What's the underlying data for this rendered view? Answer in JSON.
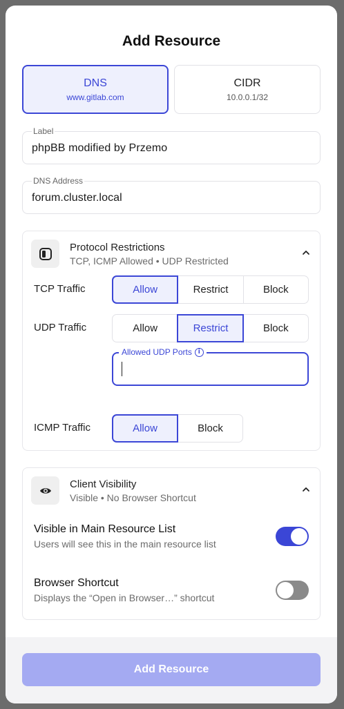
{
  "modal": {
    "title": "Add Resource"
  },
  "resource_type": {
    "options": [
      {
        "label": "DNS",
        "example": "www.gitlab.com",
        "selected": true
      },
      {
        "label": "CIDR",
        "example": "10.0.0.1/32",
        "selected": false
      }
    ]
  },
  "fields": {
    "label": {
      "label": "Label",
      "value": "phpBB modified by Przemo"
    },
    "dns_address": {
      "label": "DNS Address",
      "value": "forum.cluster.local"
    }
  },
  "protocol": {
    "title": "Protocol Restrictions",
    "summary": "TCP, ICMP Allowed • UDP Restricted",
    "rows": [
      {
        "label": "TCP Traffic",
        "options": [
          "Allow",
          "Restrict",
          "Block"
        ],
        "selected": "Allow"
      },
      {
        "label": "UDP Traffic",
        "options": [
          "Allow",
          "Restrict",
          "Block"
        ],
        "selected": "Restrict"
      },
      {
        "label": "ICMP Traffic",
        "options": [
          "Allow",
          "Block"
        ],
        "selected": "Allow"
      }
    ],
    "udp_ports": {
      "label": "Allowed UDP Ports",
      "value": ""
    }
  },
  "visibility": {
    "title": "Client Visibility",
    "summary": "Visible • No Browser Shortcut",
    "items": [
      {
        "title": "Visible in Main Resource List",
        "description": "Users will see this in the main resource list",
        "enabled": true
      },
      {
        "title": "Browser Shortcut",
        "description": "Displays the “Open in Browser…” shortcut",
        "enabled": false
      }
    ]
  },
  "footer": {
    "submit_label": "Add Resource"
  },
  "colors": {
    "accent": "#3b46d6",
    "accent_bg": "#eef0fd",
    "submit_disabled": "#a4aaf2"
  }
}
